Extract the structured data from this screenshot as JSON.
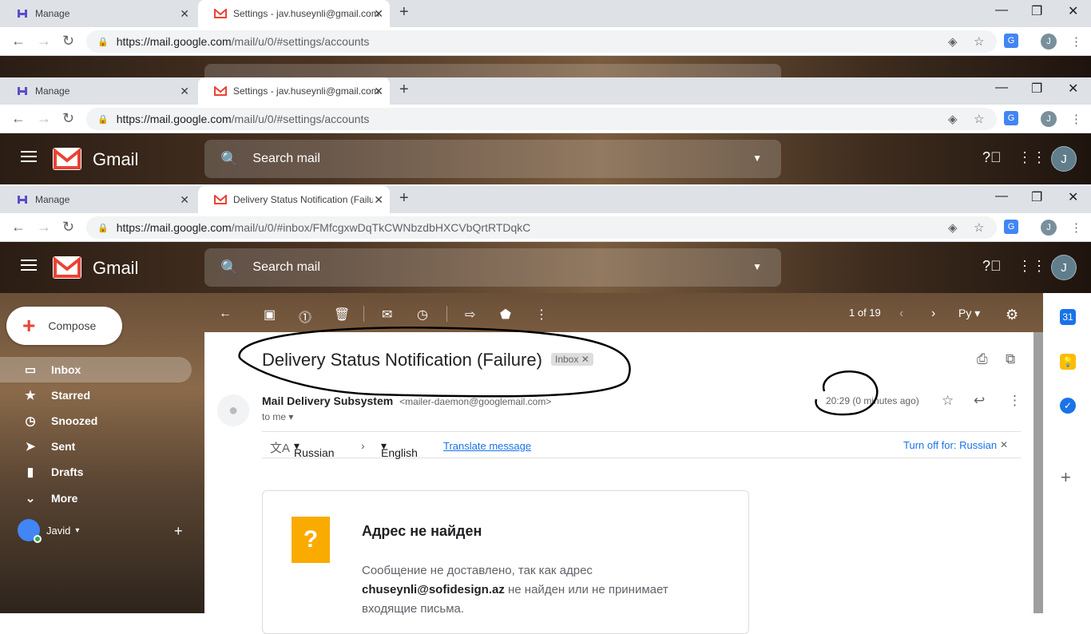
{
  "windows": [
    {
      "tabs": [
        {
          "title": "Manage",
          "active": false
        },
        {
          "title": "Settings - jav.huseynli@gmail.com",
          "active": true
        }
      ],
      "url_host": "https://mail.google.com",
      "url_path": "/mail/u/0/#settings/accounts"
    },
    {
      "tabs": [
        {
          "title": "Manage",
          "active": false
        },
        {
          "title": "Settings - jav.huseynli@gmail.com",
          "active": true
        }
      ],
      "url_host": "https://mail.google.com",
      "url_path": "/mail/u/0/#settings/accounts"
    },
    {
      "tabs": [
        {
          "title": "Manage",
          "active": false
        },
        {
          "title": "Delivery Status Notification (Failure)",
          "active": true
        }
      ],
      "url_host": "https://mail.google.com",
      "url_path": "/mail/u/0/#inbox/FMfcgxwDqTkCWNbzdbHXCVbQrtRTDqkC"
    }
  ],
  "profile_initial": "J",
  "gmail": {
    "app_name": "Gmail",
    "search_placeholder": "Search mail",
    "compose": "Compose",
    "nav": [
      {
        "label": "Inbox",
        "icon": "inbox-icon",
        "selected": true
      },
      {
        "label": "Starred",
        "icon": "star-icon",
        "selected": false
      },
      {
        "label": "Snoozed",
        "icon": "clock-icon",
        "selected": false
      },
      {
        "label": "Sent",
        "icon": "send-icon",
        "selected": false
      },
      {
        "label": "Drafts",
        "icon": "draft-icon",
        "selected": false
      },
      {
        "label": "More",
        "icon": "chevron-down-icon",
        "selected": false
      }
    ],
    "user_name": "Javid",
    "pager": "1 of 19",
    "lang_btn": "Ру"
  },
  "email": {
    "subject": "Delivery Status Notification (Failure)",
    "label": "Inbox",
    "sender_name": "Mail Delivery Subsystem",
    "sender_email": "<mailer-daemon@googlemail.com>",
    "to": "to me",
    "time": "20:29 (0 minutes ago)",
    "translate": {
      "from_lang": "Russian",
      "to_lang": "English",
      "link": "Translate message",
      "turn_off": "Turn off for: Russian"
    },
    "card": {
      "title": "Адрес не найден",
      "body_prefix": "Сообщение не доставлено, так как адрес",
      "address": "chuseynli@sofidesign.az",
      "body_suffix": "не найден или не принимает входящие письма."
    }
  },
  "colors": {
    "gmail_red": "#ea4335",
    "link_blue": "#1a73e8",
    "warning_yellow": "#f9ab00"
  }
}
